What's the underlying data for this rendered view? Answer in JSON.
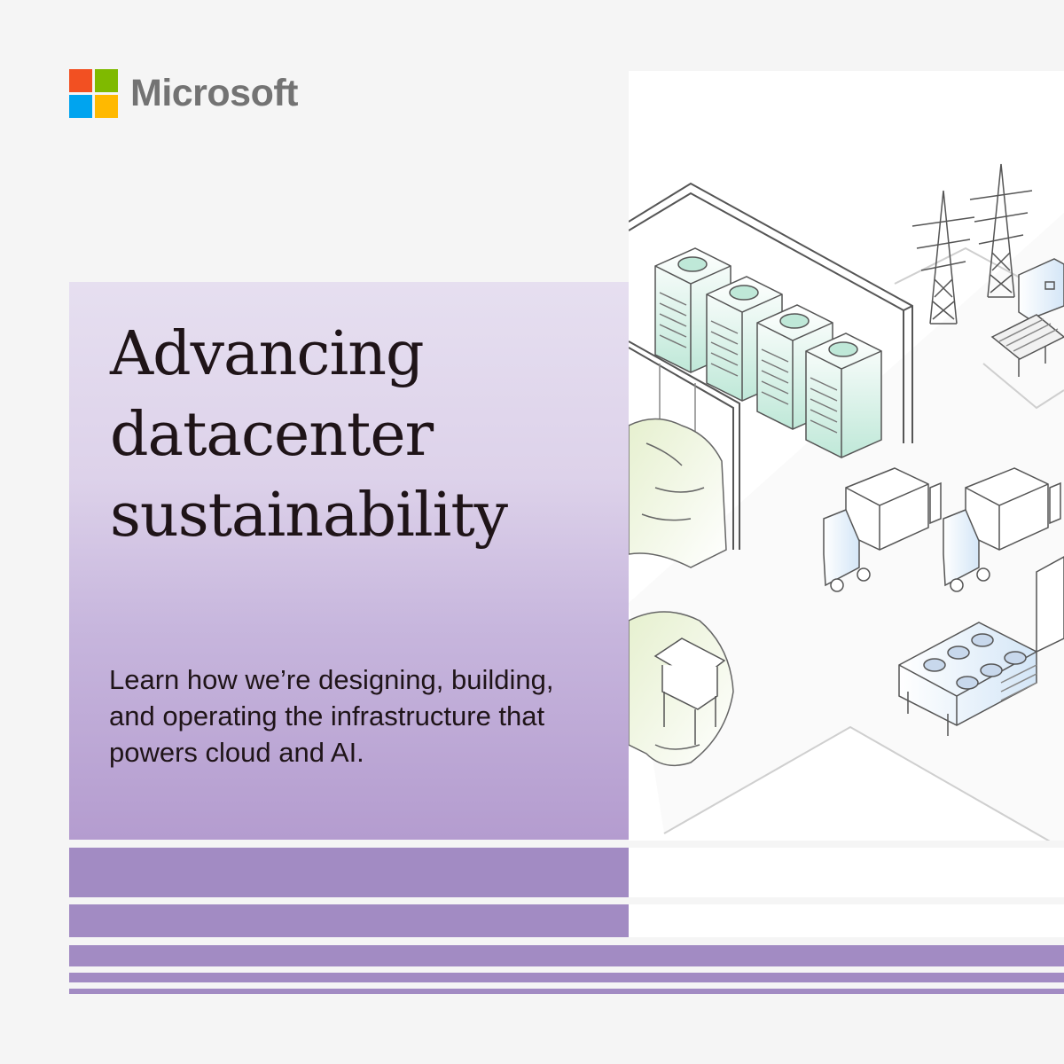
{
  "brand": {
    "name": "Microsoft",
    "logo_colors": [
      "#f25022",
      "#7fba00",
      "#00a4ef",
      "#ffb900"
    ]
  },
  "hero": {
    "headline_lines": [
      "Advancing",
      "datacenter",
      "sustainability"
    ],
    "subtitle_lines": [
      "Learn how we’re designing, building,",
      "and operating the infrastructure that",
      "powers cloud and AI."
    ]
  },
  "illustration": {
    "icons": [
      "datacenter-building-icon",
      "server-rack-icon",
      "power-tower-icon",
      "solar-panel-icon",
      "delivery-truck-icon",
      "ev-charger-icon",
      "cooling-unit-icon",
      "birdhouse-icon",
      "tree-icon"
    ]
  },
  "colors": {
    "background": "#f5f5f5",
    "panel_top": "#e6dff0",
    "panel_bottom": "#b49ccf",
    "stripe": "#a28bc3",
    "text": "#1f1418",
    "accent_green": "#bfe8d8"
  }
}
